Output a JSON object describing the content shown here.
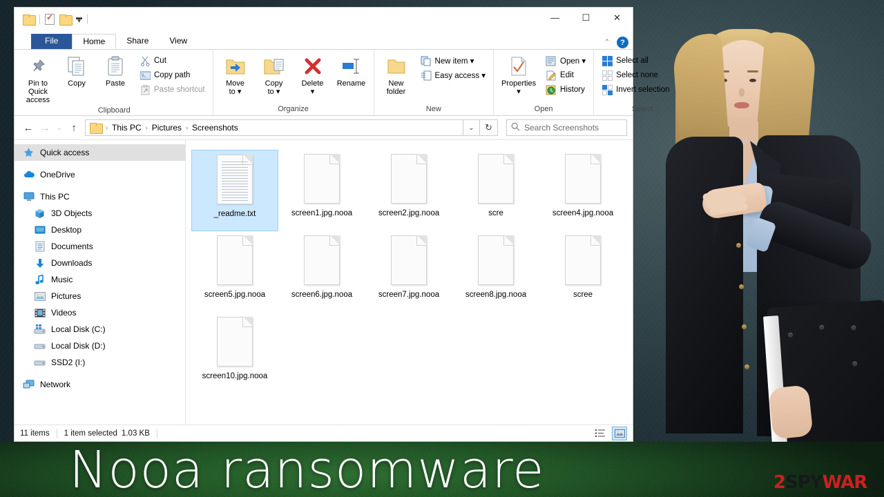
{
  "window": {
    "quick_access_toolbar": [
      {
        "name": "folder-icon",
        "label": ""
      },
      {
        "name": "properties-icon",
        "label": ""
      },
      {
        "name": "new-folder-icon",
        "label": ""
      },
      {
        "name": "customize-dropdown",
        "label": "▾"
      }
    ],
    "controls": {
      "minimize": "—",
      "maximize": "☐",
      "close": "✕"
    }
  },
  "ribbon": {
    "tabs": [
      {
        "label": "File",
        "active": false,
        "type": "file"
      },
      {
        "label": "Home",
        "active": true,
        "type": "normal"
      },
      {
        "label": "Share",
        "active": false,
        "type": "normal"
      },
      {
        "label": "View",
        "active": false,
        "type": "normal"
      }
    ],
    "collapse_label": "⌃",
    "help_label": "?",
    "groups": [
      {
        "title": "Clipboard",
        "big": [
          {
            "label": "Pin to Quick\naccess",
            "icon": "pin-icon"
          },
          {
            "label": "Copy",
            "icon": "copy-icon"
          },
          {
            "label": "Paste",
            "icon": "paste-icon"
          }
        ],
        "small": [
          {
            "label": "Cut",
            "icon": "scissors-icon",
            "dim": false
          },
          {
            "label": "Copy path",
            "icon": "copy-path-icon",
            "dim": false
          },
          {
            "label": "Paste shortcut",
            "icon": "paste-shortcut-icon",
            "dim": true
          }
        ]
      },
      {
        "title": "Organize",
        "big": [
          {
            "label": "Move\nto ▾",
            "icon": "move-to-icon"
          },
          {
            "label": "Copy\nto ▾",
            "icon": "copy-to-icon"
          },
          {
            "label": "Delete\n▾",
            "icon": "delete-icon"
          },
          {
            "label": "Rename",
            "icon": "rename-icon"
          }
        ],
        "small": []
      },
      {
        "title": "New",
        "big": [
          {
            "label": "New\nfolder",
            "icon": "new-folder-icon"
          }
        ],
        "small": [
          {
            "label": "New item ▾",
            "icon": "new-item-icon",
            "dim": false
          },
          {
            "label": "Easy access ▾",
            "icon": "easy-access-icon",
            "dim": false
          }
        ]
      },
      {
        "title": "Open",
        "big": [
          {
            "label": "Properties\n▾",
            "icon": "properties-icon"
          }
        ],
        "small": [
          {
            "label": "Open ▾",
            "icon": "open-icon",
            "dim": false
          },
          {
            "label": "Edit",
            "icon": "edit-icon",
            "dim": false
          },
          {
            "label": "History",
            "icon": "history-icon",
            "dim": false
          }
        ]
      },
      {
        "title": "Select",
        "big": [],
        "small": [
          {
            "label": "Select all",
            "icon": "select-all-icon",
            "dim": false
          },
          {
            "label": "Select none",
            "icon": "select-none-icon",
            "dim": false
          },
          {
            "label": "Invert selection",
            "icon": "invert-selection-icon",
            "dim": false
          }
        ]
      }
    ]
  },
  "addressbar": {
    "back_icon": "←",
    "forward_icon": "→",
    "recent_icon": "⌄",
    "up_icon": "↑",
    "breadcrumbs": [
      "This PC",
      "Pictures",
      "Screenshots"
    ],
    "separator": "›",
    "dropdown_icon": "⌄",
    "refresh_icon": "↻",
    "search_icon": "search-icon",
    "search_placeholder": "Search Screenshots",
    "search_value": ""
  },
  "navpane": {
    "items": [
      {
        "label": "Quick access",
        "icon": "star-pin-icon",
        "selected": true,
        "indent": false,
        "gap": false
      },
      {
        "label": "OneDrive",
        "icon": "cloud-icon",
        "selected": false,
        "indent": false,
        "gap": true
      },
      {
        "label": "This PC",
        "icon": "monitor-icon",
        "selected": false,
        "indent": false,
        "gap": true
      },
      {
        "label": "3D Objects",
        "icon": "cube-icon",
        "selected": false,
        "indent": true,
        "gap": false
      },
      {
        "label": "Desktop",
        "icon": "desktop-icon",
        "selected": false,
        "indent": true,
        "gap": false
      },
      {
        "label": "Documents",
        "icon": "documents-icon",
        "selected": false,
        "indent": true,
        "gap": false
      },
      {
        "label": "Downloads",
        "icon": "download-arrow-icon",
        "selected": false,
        "indent": true,
        "gap": false
      },
      {
        "label": "Music",
        "icon": "music-note-icon",
        "selected": false,
        "indent": true,
        "gap": false
      },
      {
        "label": "Pictures",
        "icon": "picture-icon",
        "selected": false,
        "indent": true,
        "gap": false
      },
      {
        "label": "Videos",
        "icon": "video-icon",
        "selected": false,
        "indent": true,
        "gap": false
      },
      {
        "label": "Local Disk (C:)",
        "icon": "windows-drive-icon",
        "selected": false,
        "indent": true,
        "gap": false
      },
      {
        "label": "Local Disk (D:)",
        "icon": "drive-icon",
        "selected": false,
        "indent": true,
        "gap": false
      },
      {
        "label": "SSD2 (I:)",
        "icon": "drive-icon",
        "selected": false,
        "indent": true,
        "gap": false
      },
      {
        "label": "Network",
        "icon": "network-icon",
        "selected": false,
        "indent": false,
        "gap": true
      }
    ]
  },
  "files": [
    {
      "name": "_readme.txt",
      "type": "text",
      "selected": true,
      "occluded": false
    },
    {
      "name": "screen1.jpg.nooa",
      "type": "blank",
      "selected": false,
      "occluded": false
    },
    {
      "name": "screen2.jpg.nooa",
      "type": "blank",
      "selected": false,
      "occluded": false
    },
    {
      "name": "scre",
      "type": "blank",
      "selected": false,
      "occluded": true
    },
    {
      "name": "screen4.jpg.nooa",
      "type": "blank",
      "selected": false,
      "occluded": false
    },
    {
      "name": "screen5.jpg.nooa",
      "type": "blank",
      "selected": false,
      "occluded": false
    },
    {
      "name": "screen6.jpg.nooa",
      "type": "blank",
      "selected": false,
      "occluded": false
    },
    {
      "name": "screen7.jpg.nooa",
      "type": "blank",
      "selected": false,
      "occluded": false
    },
    {
      "name": "screen8.jpg.nooa",
      "type": "blank",
      "selected": false,
      "occluded": false
    },
    {
      "name": "scree",
      "type": "blank",
      "selected": false,
      "occluded": true
    },
    {
      "name": "screen10.jpg.nooa",
      "type": "blank",
      "selected": false,
      "occluded": false
    }
  ],
  "statusbar": {
    "item_count": "11 items",
    "selection": "1 item selected",
    "size": "1.03 KB",
    "view_details_icon": "details-view-icon",
    "view_large_icon": "large-icons-view-icon"
  },
  "banner": {
    "title": "Nooa ransomware",
    "watermark": {
      "prefix": "2",
      "mid": "SPY",
      "suffix": "WAR",
      "tail": "≼"
    },
    "colors": {
      "accent_red": "#cc1f1f",
      "dark": "#17181a",
      "green": "#1f5424"
    }
  }
}
